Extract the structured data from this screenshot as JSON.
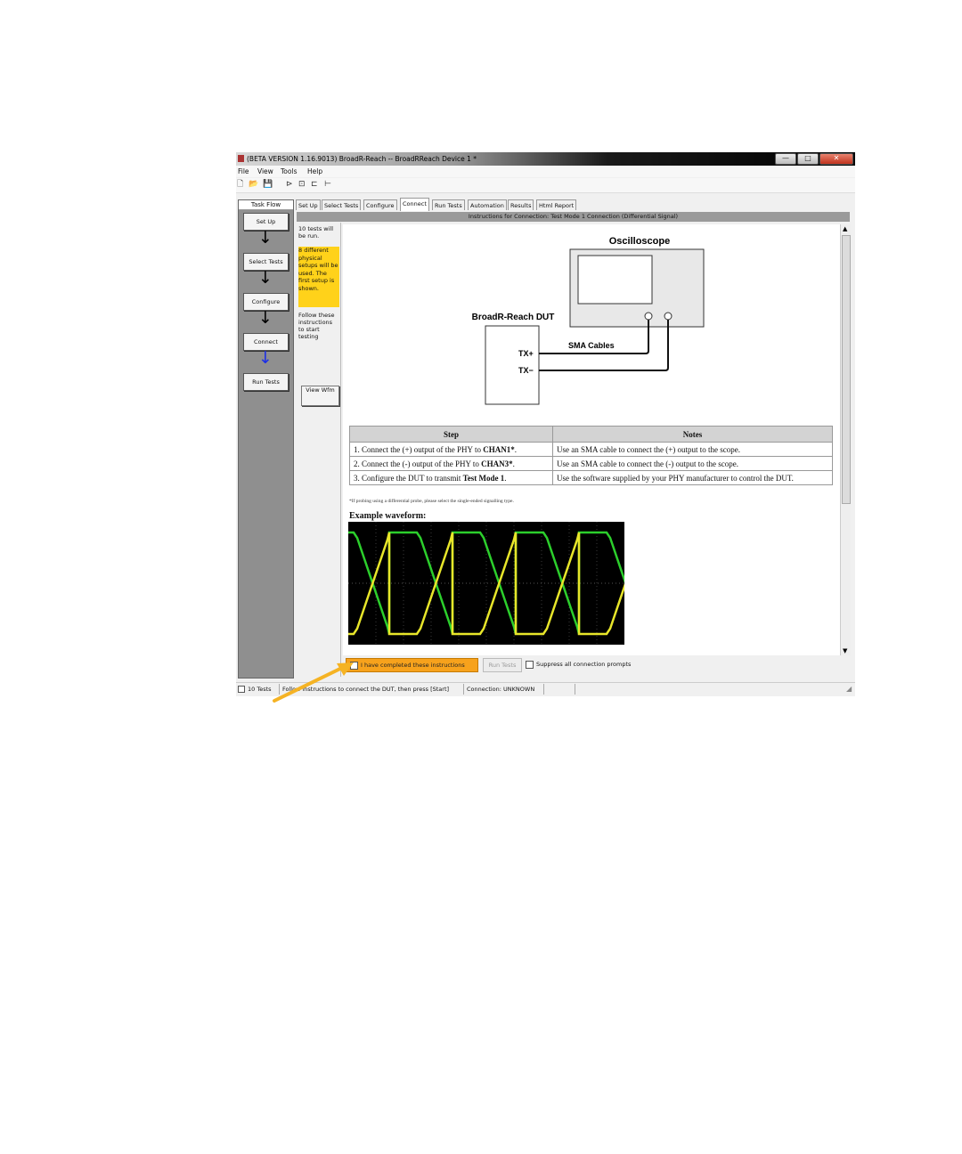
{
  "window": {
    "title": "(BETA VERSION 1.16.9013) BroadR-Reach -- BroadRReach Device 1 *",
    "min": "—",
    "max": "□",
    "close": "✕"
  },
  "menu": [
    "File",
    "View",
    "Tools",
    "Help"
  ],
  "toolbar_icons": [
    "new-file-icon",
    "open-folder-icon",
    "save-icon",
    "run-icon",
    "stop-icon"
  ],
  "taskflow": {
    "header": "Task Flow",
    "items": [
      "Set Up",
      "Select Tests",
      "Configure",
      "Connect",
      "Run Tests"
    ],
    "arrow": "↓"
  },
  "tabs": [
    "Set Up",
    "Select Tests",
    "Configure",
    "Connect",
    "Run Tests",
    "Automation",
    "Results",
    "Html Report"
  ],
  "active_tab": "Connect",
  "banner": "Instructions for Connection: Test Mode 1 Connection (Differential Signal)",
  "left_pane": {
    "tests_text": "10 tests will be run.",
    "setups_text": "8 different physical setups will be used. The first setup is shown.",
    "follow_text": "Follow these instructions to start testing",
    "view_wfm": "View Wfm"
  },
  "diagram": {
    "scope_label": "Oscilloscope",
    "dut_label": "BroadR-Reach DUT",
    "tx_plus": "TX+",
    "tx_minus": "TX−",
    "cables": "SMA Cables"
  },
  "steps_table": {
    "headers": [
      "Step",
      "Notes"
    ],
    "rows": [
      {
        "pre": "1. Connect the (+) output of the PHY to ",
        "bold": "CHAN1*",
        "post": ".",
        "note": "Use an SMA cable to connect the (+) output to the scope."
      },
      {
        "pre": "2. Connect the (-) output of the PHY to ",
        "bold": "CHAN3*",
        "post": ".",
        "note": "Use an SMA cable to connect the (-) output to the scope."
      },
      {
        "pre": "3. Configure the DUT to transmit ",
        "bold": "Test Mode 1",
        "post": ".",
        "note": "Use the software supplied by your PHY manufacturer to control the DUT."
      }
    ]
  },
  "footnote": "*If probing using a differential probe, please select the single-ended signalling type.",
  "example_title": "Example waveform:",
  "colors": {
    "waveform_yellow": "#e8e62a",
    "waveform_green": "#2ccf2c",
    "highlight_orange": "#f7a21c",
    "callout_arrow": "#f5b324"
  },
  "bottom": {
    "complete_label": "I have completed these instructions",
    "run_tests": "Run Tests",
    "suppress": "Suppress all connection prompts"
  },
  "status": {
    "tests": "10 Tests",
    "message": "Follow instructions to connect the DUT, then press [Start]",
    "connection": "Connection: UNKNOWN"
  }
}
